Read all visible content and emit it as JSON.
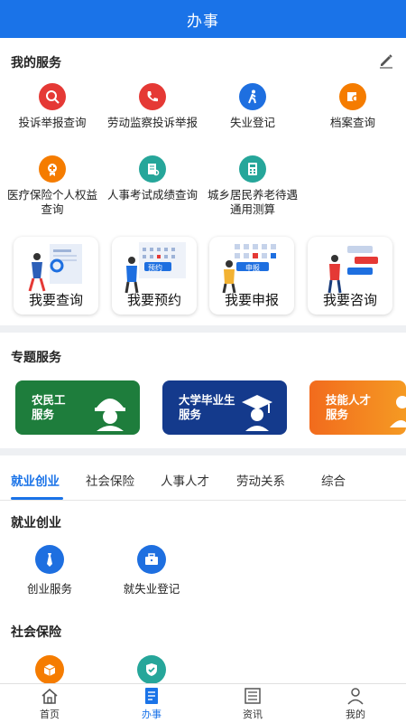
{
  "header": {
    "title": "办事"
  },
  "my_services": {
    "title": "我的服务",
    "edit_icon": "pencil-icon",
    "items": [
      {
        "label": "投诉举报查询",
        "icon": "search-report-icon",
        "color": "#e53935"
      },
      {
        "label": "劳动监察投诉举报",
        "icon": "phone-icon",
        "color": "#e53935"
      },
      {
        "label": "失业登记",
        "icon": "walking-person-icon",
        "color": "#1e6fe0"
      },
      {
        "label": "档案查询",
        "icon": "archive-search-icon",
        "color": "#f57c00"
      },
      {
        "label": "医疗保险个人权益查询",
        "icon": "medical-insurance-icon",
        "color": "#f57c00"
      },
      {
        "label": "人事考试成绩查询",
        "icon": "exam-score-icon",
        "color": "#26a69a"
      },
      {
        "label": "城乡居民养老待遇通用测算",
        "icon": "calculator-icon",
        "color": "#26a69a"
      }
    ],
    "quick_cards": [
      {
        "label": "我要查询",
        "icon": "query-illustration"
      },
      {
        "label": "我要预约",
        "icon": "appointment-illustration",
        "tag": "预约"
      },
      {
        "label": "我要申报",
        "icon": "declare-illustration",
        "tag": "申报"
      },
      {
        "label": "我要咨询",
        "icon": "consult-illustration"
      }
    ]
  },
  "topic_services": {
    "title": "专题服务",
    "cards": [
      {
        "label_line1": "农民工",
        "label_line2": "服务",
        "color": "#1e7d3c",
        "icon": "worker-helmet-icon"
      },
      {
        "label_line1": "大学毕业生",
        "label_line2": "服务",
        "color": "#143a8c",
        "icon": "graduate-cap-icon"
      },
      {
        "label_line1": "技能人才",
        "label_line2": "服务",
        "color": "#f26b1d",
        "icon": "skilled-talent-icon"
      }
    ]
  },
  "tabs": [
    {
      "label": "就业创业",
      "active": true
    },
    {
      "label": "社会保险",
      "active": false
    },
    {
      "label": "人事人才",
      "active": false
    },
    {
      "label": "劳动关系",
      "active": false
    },
    {
      "label": "综合",
      "active": false
    }
  ],
  "employment": {
    "title": "就业创业",
    "items": [
      {
        "label": "创业服务",
        "icon": "tie-icon",
        "color": "#1e6fe0"
      },
      {
        "label": "就失业登记",
        "icon": "briefcase-icon",
        "color": "#1e6fe0"
      }
    ]
  },
  "social_insurance": {
    "title": "社会保险",
    "items": [
      {
        "icon": "box-icon",
        "color": "#f57c00"
      },
      {
        "icon": "shield-check-icon",
        "color": "#26a69a"
      }
    ]
  },
  "bottom_nav": [
    {
      "label": "首页",
      "icon": "home-icon",
      "active": false
    },
    {
      "label": "办事",
      "icon": "task-icon",
      "active": true
    },
    {
      "label": "资讯",
      "icon": "news-icon",
      "active": false
    },
    {
      "label": "我的",
      "icon": "user-icon",
      "active": false
    }
  ]
}
